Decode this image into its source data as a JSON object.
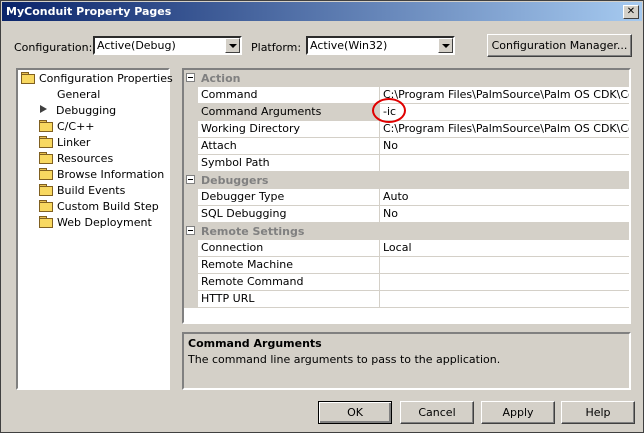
{
  "window": {
    "title": "MyConduit Property Pages"
  },
  "toolbar": {
    "configuration_label": "Configuration:",
    "configuration_value": "Active(Debug)",
    "platform_label": "Platform:",
    "platform_value": "Active(Win32)",
    "config_manager_label": "Configuration Manager..."
  },
  "tree": {
    "root": "Configuration Properties",
    "items": [
      "General",
      "Debugging",
      "C/C++",
      "Linker",
      "Resources",
      "Browse Information",
      "Build Events",
      "Custom Build Step",
      "Web Deployment"
    ]
  },
  "grid": {
    "categories": {
      "action": "Action",
      "debuggers": "Debuggers",
      "remote": "Remote Settings"
    },
    "rows": [
      {
        "name": "Command",
        "value": "C:\\Program Files\\PalmSource\\Palm OS CDK\\Common"
      },
      {
        "name": "Command Arguments",
        "value": "-ic"
      },
      {
        "name": "Working Directory",
        "value": "C:\\Program Files\\PalmSource\\Palm OS CDK\\Common"
      },
      {
        "name": "Attach",
        "value": "No"
      },
      {
        "name": "Symbol Path",
        "value": ""
      },
      {
        "name": "Debugger Type",
        "value": "Auto"
      },
      {
        "name": "SQL Debugging",
        "value": "No"
      },
      {
        "name": "Connection",
        "value": "Local"
      },
      {
        "name": "Remote Machine",
        "value": ""
      },
      {
        "name": "Remote Command",
        "value": ""
      },
      {
        "name": "HTTP URL",
        "value": ""
      }
    ]
  },
  "description": {
    "title": "Command Arguments",
    "text": "The command line arguments to pass to the application."
  },
  "buttons": {
    "ok": "OK",
    "cancel": "Cancel",
    "apply": "Apply",
    "help": "Help"
  },
  "colors": {
    "titlebar_start": "#0a246a",
    "titlebar_end": "#a6caf0",
    "annotation_circle": "#e00000"
  },
  "icons": {
    "folder": "folder-icon",
    "selected_arrow": "arrow-right-icon",
    "close": "close-icon"
  }
}
